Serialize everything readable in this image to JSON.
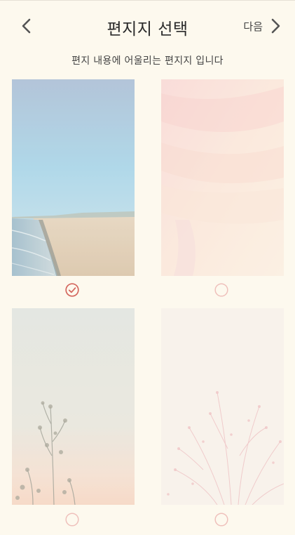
{
  "header": {
    "title": "편지지 선택",
    "next_label": "다음"
  },
  "subtitle": "편지 내용에 어울리는 편지지 입니다",
  "colors": {
    "background": "#fdf9ee",
    "accent": "#d4675e",
    "radio_unselected": "#efc0bb"
  },
  "stationery": [
    {
      "name": "beach",
      "selected": true
    },
    {
      "name": "pink-watercolor",
      "selected": false
    },
    {
      "name": "wildflower-sunset",
      "selected": false
    },
    {
      "name": "pink-grass",
      "selected": false
    }
  ]
}
